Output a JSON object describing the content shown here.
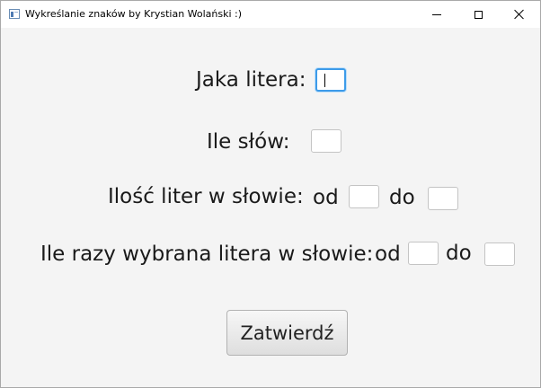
{
  "window": {
    "title": "Wykreślanie znaków by Krystian Wolański :)"
  },
  "form": {
    "letter_label": "Jaka litera:",
    "words_label": "Ile słów:",
    "length_label": "Ilość liter w słowie:",
    "occurrence_label": "Ile razy wybrana litera w słowie:",
    "from_label": "od",
    "to_label": "do",
    "letter_value": "",
    "words_value": "",
    "length_from_value": "",
    "length_to_value": "",
    "occurrence_from_value": "",
    "occurrence_to_value": "",
    "submit_label": "Zatwierdź"
  },
  "icons": {
    "app": "app-window-icon",
    "minimize": "minimize-icon",
    "maximize": "maximize-icon",
    "close": "close-icon"
  }
}
